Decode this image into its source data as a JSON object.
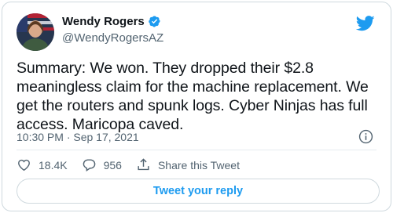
{
  "author": {
    "name": "Wendy Rogers",
    "handle": "@WendyRogersAZ",
    "verified": true
  },
  "tweet": {
    "text": "Summary: We won. They dropped their $2.8 meaningless claim for the machine replacement. We get the routers and spunk logs. Cyber Ninjas has full access. Maricopa caved.",
    "timestamp": "10:30 PM · Sep 17, 2021"
  },
  "actions": {
    "likes": "18.4K",
    "replies": "956",
    "share_label": "Share this Tweet"
  },
  "reply_button_label": "Tweet your reply",
  "colors": {
    "brand_blue": "#1d9bf0",
    "text_primary": "#0f1419",
    "text_secondary": "#536471",
    "like_red": "#f91880"
  },
  "icons": {
    "brand": "twitter-bird-icon",
    "verified": "verified-badge-icon",
    "info": "info-icon",
    "like": "heart-icon",
    "reply": "speech-bubble-icon",
    "share": "share-upload-icon"
  }
}
